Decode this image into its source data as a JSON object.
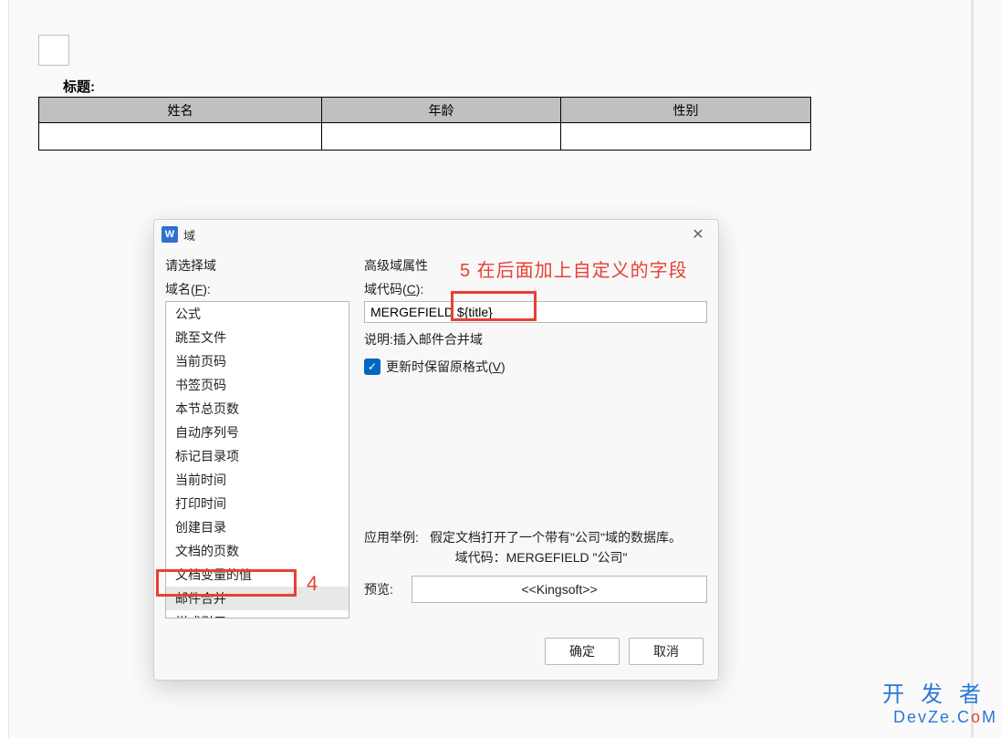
{
  "document": {
    "title_label": "标题:",
    "table": {
      "headers": [
        "姓名",
        "年龄",
        "性别"
      ],
      "rows": [
        [
          "",
          "",
          ""
        ]
      ]
    }
  },
  "dialog": {
    "icon_letter": "W",
    "title": "域",
    "close_glyph": "✕",
    "left": {
      "select_label": "请选择域",
      "field_name_label_pre": "域名(",
      "field_name_key": "F",
      "field_name_label_post": "):",
      "items": [
        "公式",
        "跳至文件",
        "当前页码",
        "书签页码",
        "本节总页数",
        "自动序列号",
        "标记目录项",
        "当前时间",
        "打印时间",
        "创建目录",
        "文档的页数",
        "文档变量的值",
        "邮件合并",
        "样式引用"
      ],
      "selected_index": 12
    },
    "right": {
      "adv_props_label": "高级域属性",
      "code_label_pre": "域代码(",
      "code_key": "C",
      "code_label_post": "):",
      "code_value": "MERGEFIELD ${title}",
      "desc_label": "说明:",
      "desc_value": "插入邮件合并域",
      "checkbox_checked": true,
      "checkbox_label_pre": "更新时保留原格式(",
      "checkbox_key": "V",
      "checkbox_label_post": ")",
      "example_label": "应用举例:",
      "example_text": "假定文档打开了一个带有\"公司\"域的数据库。",
      "example_code_label": "域代码：",
      "example_code_value": "MERGEFIELD \"公司\"",
      "preview_label": "预览:",
      "preview_value": "<<Kingsoft>>"
    },
    "buttons": {
      "ok": "确定",
      "cancel": "取消"
    }
  },
  "annotations": {
    "num4": "4",
    "num5_text": "5 在后面加上自定义的字段"
  },
  "watermark": {
    "top": "开发者",
    "bottom_pre": "DevZe.C",
    "bottom_o": "o",
    "bottom_post": "M"
  }
}
